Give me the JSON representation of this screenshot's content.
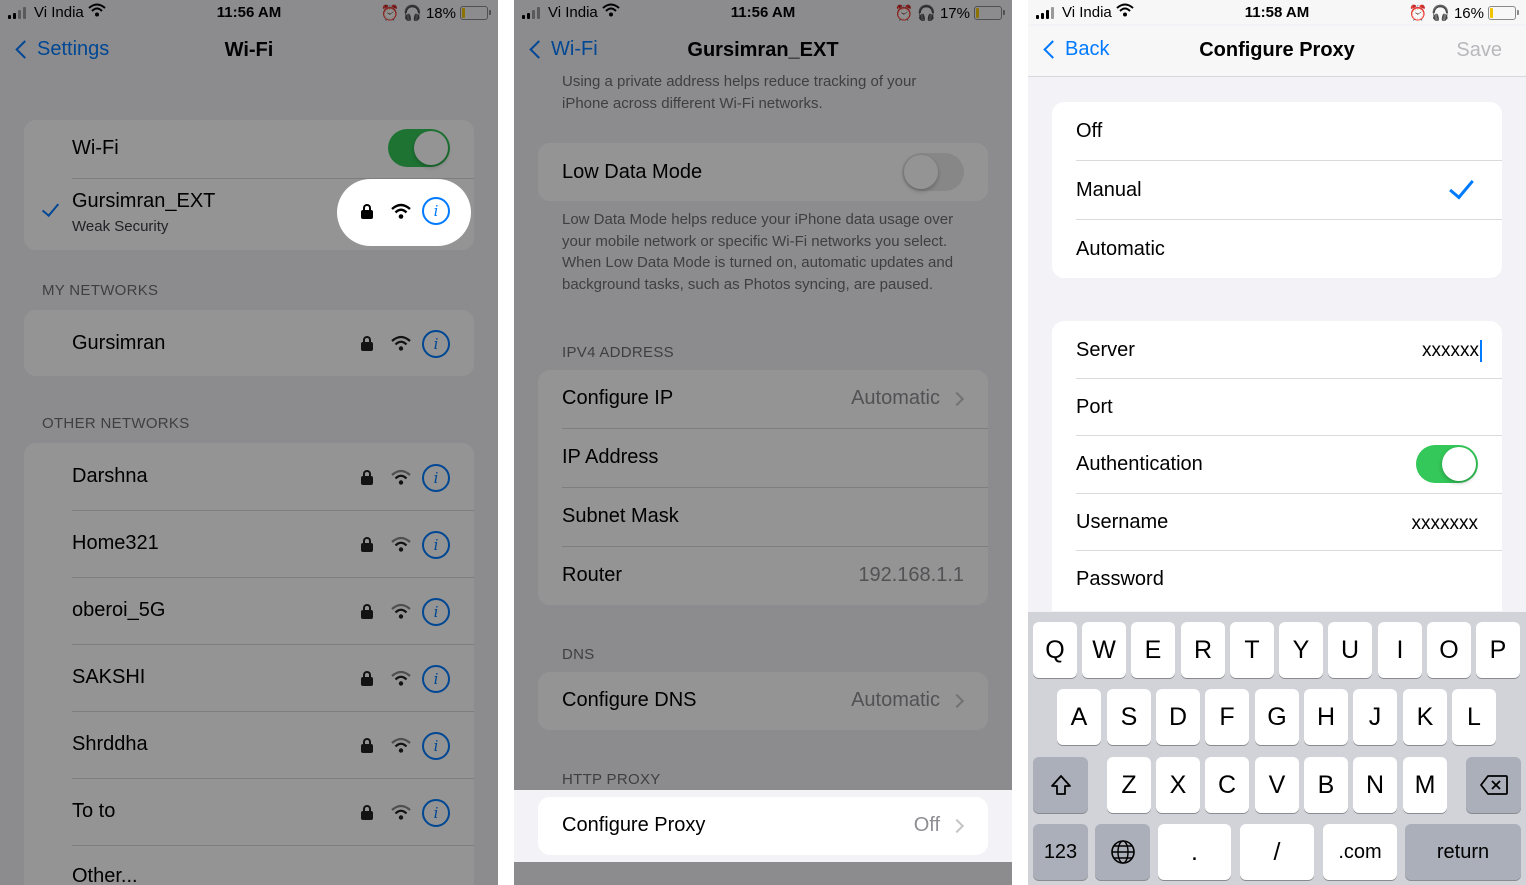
{
  "screen1": {
    "status": {
      "carrier": "Vi India",
      "time": "11:56 AM",
      "battery": "18%"
    },
    "nav": {
      "back": "Settings",
      "title": "Wi-Fi"
    },
    "wifi_label": "Wi-Fi",
    "connected": {
      "name": "Gursimran_EXT",
      "sub": "Weak Security"
    },
    "my_networks_header": "MY NETWORKS",
    "my_networks": [
      "Gursimran"
    ],
    "other_networks_header": "OTHER NETWORKS",
    "other_networks": [
      "Darshna",
      "Home321",
      "oberoi_5G",
      "SAKSHI",
      "Shrddha",
      "To to"
    ],
    "other": "Other..."
  },
  "screen2": {
    "status": {
      "carrier": "Vi India",
      "time": "11:56 AM",
      "battery": "17%"
    },
    "nav": {
      "back": "Wi-Fi",
      "title": "Gursimran_EXT"
    },
    "private_note": "Using a private address helps reduce tracking of your iPhone across different Wi-Fi networks.",
    "low_data_label": "Low Data Mode",
    "low_data_note": "Low Data Mode helps reduce your iPhone data usage over your mobile network or specific Wi-Fi networks you select. When Low Data Mode is turned on, automatic updates and background tasks, such as Photos syncing, are paused.",
    "ipv4_header": "IPV4 ADDRESS",
    "configure_ip": {
      "label": "Configure IP",
      "value": "Automatic"
    },
    "ip_address": "IP Address",
    "subnet_mask": "Subnet Mask",
    "router": {
      "label": "Router",
      "value": "192.168.1.1"
    },
    "dns_header": "DNS",
    "configure_dns": {
      "label": "Configure DNS",
      "value": "Automatic"
    },
    "proxy_header": "HTTP PROXY",
    "configure_proxy": {
      "label": "Configure Proxy",
      "value": "Off"
    }
  },
  "screen3": {
    "status": {
      "carrier": "Vi India",
      "time": "11:58 AM",
      "battery": "16%"
    },
    "nav": {
      "back": "Back",
      "title": "Configure Proxy",
      "save": "Save"
    },
    "modes": [
      "Off",
      "Manual",
      "Automatic"
    ],
    "selected_mode": "Manual",
    "server": {
      "label": "Server",
      "value": "xxxxxx"
    },
    "port": "Port",
    "authentication": {
      "label": "Authentication",
      "on": true
    },
    "username": {
      "label": "Username",
      "value": "xxxxxxx"
    },
    "password": "Password",
    "keyboard": {
      "row1": [
        "Q",
        "W",
        "E",
        "R",
        "T",
        "Y",
        "U",
        "I",
        "O",
        "P"
      ],
      "row2": [
        "A",
        "S",
        "D",
        "F",
        "G",
        "H",
        "J",
        "K",
        "L"
      ],
      "row3": [
        "Z",
        "X",
        "C",
        "V",
        "B",
        "N",
        "M"
      ],
      "numbers": "123",
      "dot": ".",
      "slash": "/",
      "dotcom": ".com",
      "return": "return"
    }
  },
  "colors": {
    "accent": "#007aff",
    "toggle_on": "#34c759",
    "battery": "#f2c400"
  }
}
